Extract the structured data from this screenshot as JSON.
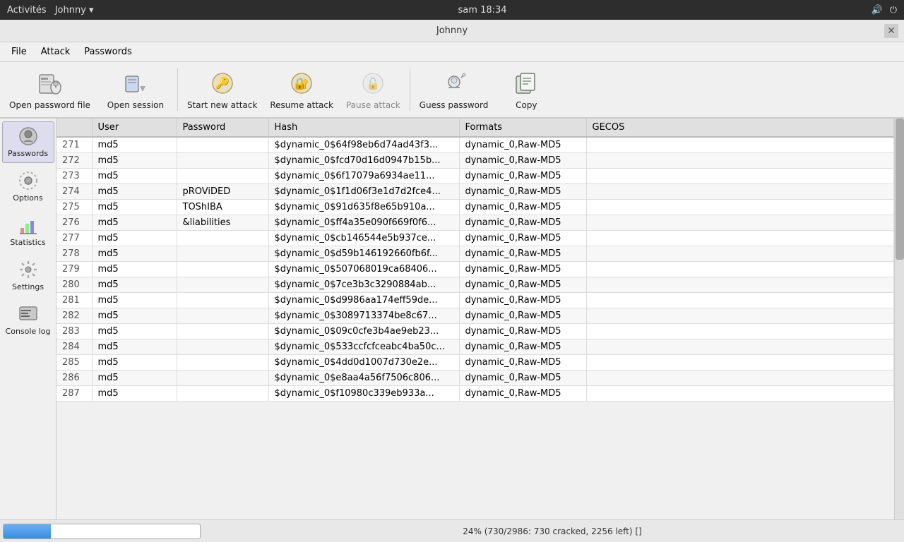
{
  "system_bar": {
    "left": "Activités",
    "app_name": "Johnny ▾",
    "time": "sam 18:34"
  },
  "window": {
    "title": "Johnny"
  },
  "menu": {
    "items": [
      "File",
      "Attack",
      "Passwords"
    ]
  },
  "toolbar": {
    "open_pw_label": "Open password file",
    "open_session_label": "Open session",
    "start_label": "Start new attack",
    "resume_label": "Resume attack",
    "pause_label": "Pause attack",
    "guess_label": "Guess password",
    "copy_label": "Copy"
  },
  "sidebar": {
    "items": [
      {
        "label": "Passwords",
        "icon": "🔑"
      },
      {
        "label": "Options",
        "icon": "⚙️"
      },
      {
        "label": "Statistics",
        "icon": "📊"
      },
      {
        "label": "Settings",
        "icon": "🔧"
      },
      {
        "label": "Console log",
        "icon": "🖥️"
      }
    ]
  },
  "table": {
    "columns": [
      "",
      "User",
      "Password",
      "Hash",
      "Formats",
      "GECOS"
    ],
    "rows": [
      {
        "num": "271",
        "user": "md5",
        "password": "",
        "hash": "$dynamic_0$64f98eb6d74ad43f3...",
        "formats": "dynamic_0,Raw-MD5",
        "gecos": ""
      },
      {
        "num": "272",
        "user": "md5",
        "password": "",
        "hash": "$dynamic_0$fcd70d16d0947b15b...",
        "formats": "dynamic_0,Raw-MD5",
        "gecos": ""
      },
      {
        "num": "273",
        "user": "md5",
        "password": "",
        "hash": "$dynamic_0$6f17079a6934ae11...",
        "formats": "dynamic_0,Raw-MD5",
        "gecos": ""
      },
      {
        "num": "274",
        "user": "md5",
        "password": "pROViDED",
        "hash": "$dynamic_0$1f1d06f3e1d7d2fce4...",
        "formats": "dynamic_0,Raw-MD5",
        "gecos": ""
      },
      {
        "num": "275",
        "user": "md5",
        "password": "TOShIBA",
        "hash": "$dynamic_0$91d635f8e65b910a...",
        "formats": "dynamic_0,Raw-MD5",
        "gecos": ""
      },
      {
        "num": "276",
        "user": "md5",
        "password": "&liabilities",
        "hash": "$dynamic_0$ff4a35e090f669f0f6...",
        "formats": "dynamic_0,Raw-MD5",
        "gecos": ""
      },
      {
        "num": "277",
        "user": "md5",
        "password": "",
        "hash": "$dynamic_0$cb146544e5b937ce...",
        "formats": "dynamic_0,Raw-MD5",
        "gecos": ""
      },
      {
        "num": "278",
        "user": "md5",
        "password": "",
        "hash": "$dynamic_0$d59b146192660fb6f...",
        "formats": "dynamic_0,Raw-MD5",
        "gecos": ""
      },
      {
        "num": "279",
        "user": "md5",
        "password": "",
        "hash": "$dynamic_0$507068019ca68406...",
        "formats": "dynamic_0,Raw-MD5",
        "gecos": ""
      },
      {
        "num": "280",
        "user": "md5",
        "password": "",
        "hash": "$dynamic_0$7ce3b3c3290884ab...",
        "formats": "dynamic_0,Raw-MD5",
        "gecos": ""
      },
      {
        "num": "281",
        "user": "md5",
        "password": "",
        "hash": "$dynamic_0$d9986aa174eff59de...",
        "formats": "dynamic_0,Raw-MD5",
        "gecos": ""
      },
      {
        "num": "282",
        "user": "md5",
        "password": "",
        "hash": "$dynamic_0$3089713374be8c67...",
        "formats": "dynamic_0,Raw-MD5",
        "gecos": ""
      },
      {
        "num": "283",
        "user": "md5",
        "password": "",
        "hash": "$dynamic_0$09c0cfe3b4ae9eb23...",
        "formats": "dynamic_0,Raw-MD5",
        "gecos": ""
      },
      {
        "num": "284",
        "user": "md5",
        "password": "",
        "hash": "$dynamic_0$533ccfcfceabc4ba50c...",
        "formats": "dynamic_0,Raw-MD5",
        "gecos": ""
      },
      {
        "num": "285",
        "user": "md5",
        "password": "",
        "hash": "$dynamic_0$4dd0d1007d730e2e...",
        "formats": "dynamic_0,Raw-MD5",
        "gecos": ""
      },
      {
        "num": "286",
        "user": "md5",
        "password": "",
        "hash": "$dynamic_0$e8aa4a56f7506c806...",
        "formats": "dynamic_0,Raw-MD5",
        "gecos": ""
      },
      {
        "num": "287",
        "user": "md5",
        "password": "",
        "hash": "$dynamic_0$f10980c339eb933a...",
        "formats": "dynamic_0,Raw-MD5",
        "gecos": ""
      }
    ]
  },
  "status": {
    "progress_percent": 24,
    "text": "24% (730/2986: 730 cracked, 2256 left) []"
  }
}
